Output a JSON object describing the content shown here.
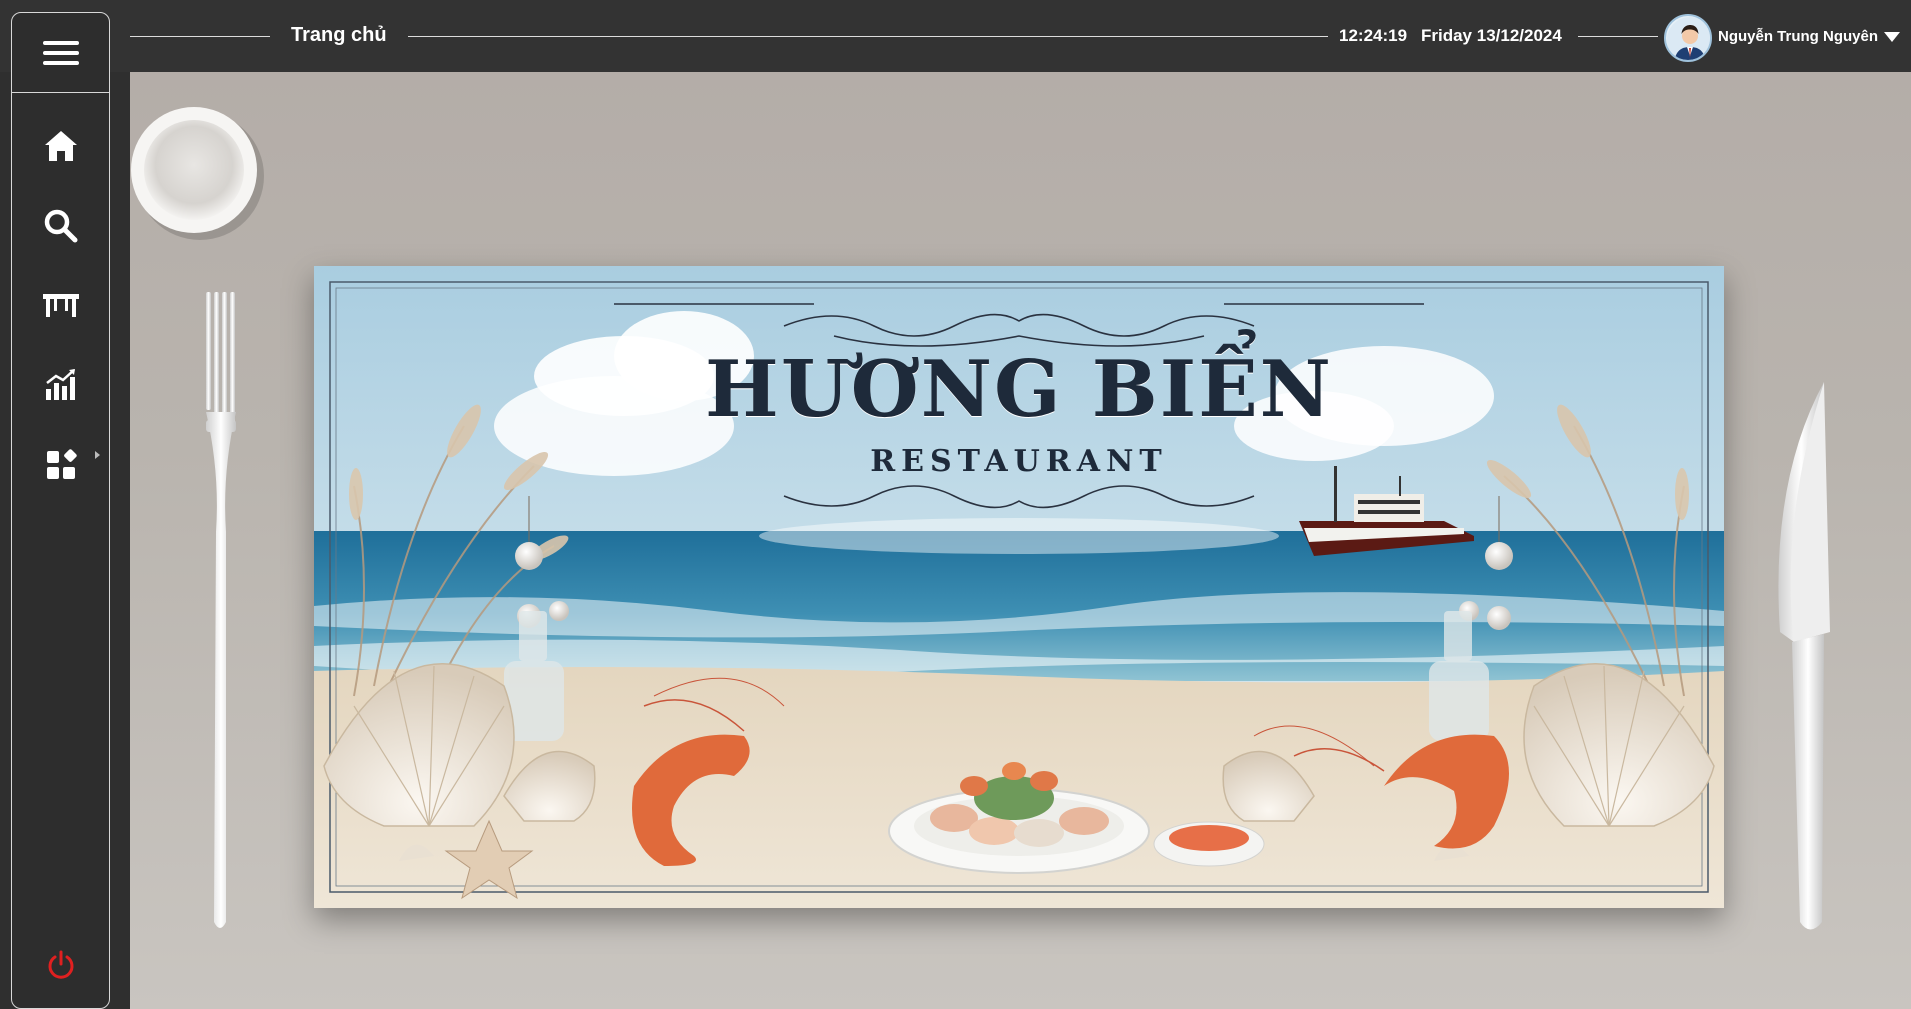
{
  "header": {
    "page_title": "Trang chủ",
    "time": "12:24:19",
    "date": "Friday 13/12/2024",
    "user_name": "Nguyễn Trung Nguyên"
  },
  "sidebar": {
    "items": [
      {
        "icon": "home-icon"
      },
      {
        "icon": "search-icon"
      },
      {
        "icon": "table-icon"
      },
      {
        "icon": "chart-icon"
      },
      {
        "icon": "apps-icon"
      }
    ],
    "power_icon": "power-icon"
  },
  "banner": {
    "title": "HƯƠNG BIỂN",
    "subtitle": "RESTAURANT"
  },
  "colors": {
    "topbar": "#333333",
    "sidebar": "#2d2d2d",
    "power": "#e02020",
    "sea": "#2f7fa6",
    "sand": "#e9ddca",
    "title": "#1e2a3a"
  }
}
